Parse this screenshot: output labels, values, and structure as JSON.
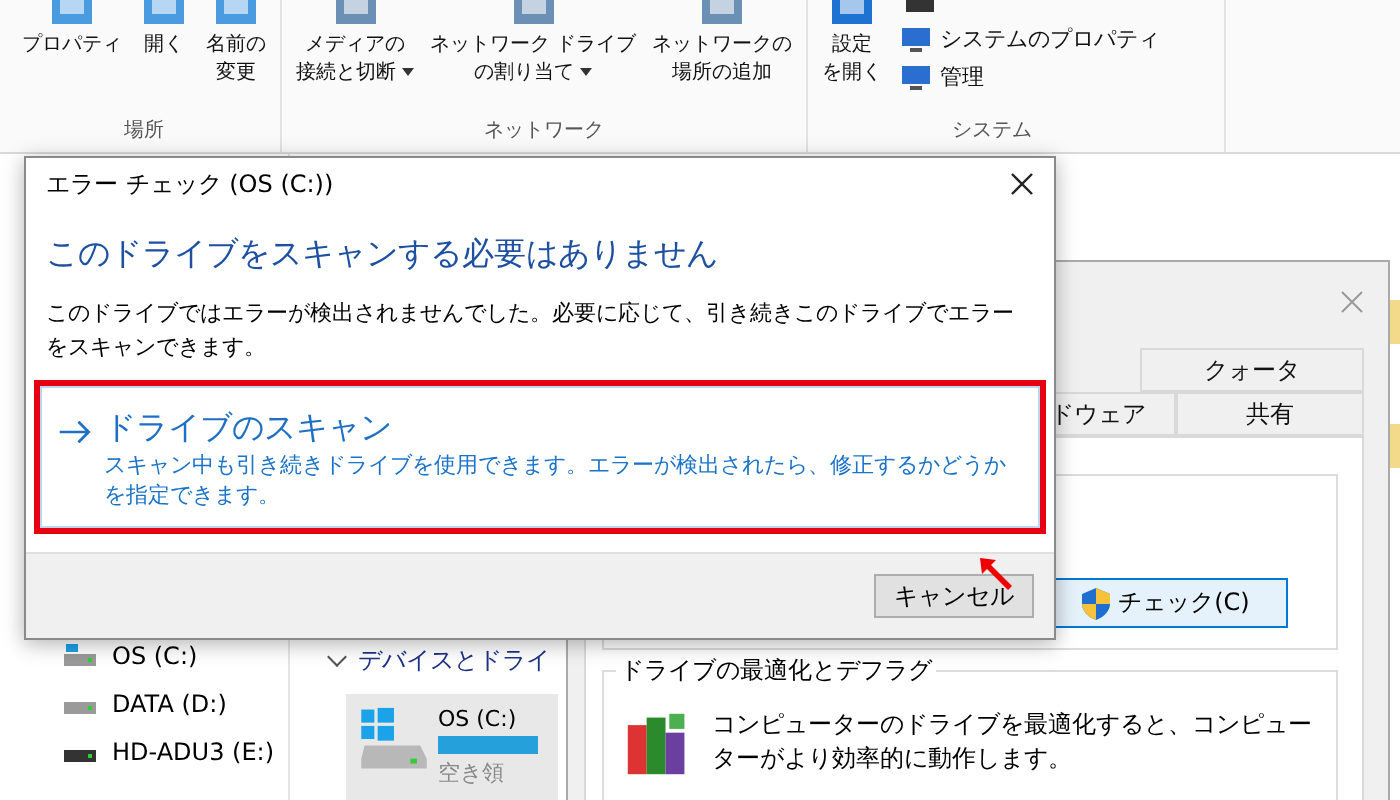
{
  "ribbon": {
    "groups": [
      {
        "label": "場所",
        "items": [
          {
            "kind": "large",
            "lines": [
              "プロパティ"
            ],
            "dropdown": false
          },
          {
            "kind": "large",
            "lines": [
              "開く"
            ],
            "dropdown": false
          },
          {
            "kind": "large",
            "lines": [
              "名前の",
              "変更"
            ],
            "dropdown": false
          }
        ]
      },
      {
        "label": "ネットワーク",
        "items": [
          {
            "kind": "large",
            "lines": [
              "メディアの",
              "接続と切断"
            ],
            "dropdown": true
          },
          {
            "kind": "large",
            "lines": [
              "ネットワーク ドライブ",
              "の割り当て"
            ],
            "dropdown": true
          },
          {
            "kind": "large",
            "lines": [
              "ネットワークの",
              "場所の追加"
            ],
            "dropdown": false
          }
        ]
      },
      {
        "label": "システム",
        "items": [
          {
            "kind": "large",
            "lines": [
              "設定",
              "を開く"
            ],
            "dropdown": false
          },
          {
            "kind": "small",
            "lines": [
              "システムのプロパティ"
            ],
            "dropdown": false
          },
          {
            "kind": "small",
            "lines": [
              "管理"
            ],
            "dropdown": false
          }
        ]
      }
    ]
  },
  "navigation": {
    "items": [
      {
        "label": "OS (C:)",
        "kind": "system"
      },
      {
        "label": "DATA (D:)",
        "kind": "drive"
      },
      {
        "label": "HD-ADU3 (E:)",
        "kind": "external"
      }
    ]
  },
  "content": {
    "section": {
      "title": "デバイスとドライ",
      "expanded": true
    },
    "drive": {
      "name": "OS (C:)",
      "detail": "空き領"
    }
  },
  "properties_window": {
    "tab_rows": [
      [
        {
          "label": "クォータ",
          "selected": false
        }
      ],
      [
        {
          "label": "ドウェア",
          "selected": false
        },
        {
          "label": "共有",
          "selected": false
        }
      ]
    ],
    "check_button": "チェック(C)",
    "optimize": {
      "title": "ドライブの最適化とデフラグ",
      "description": "コンピューターのドライブを最適化すると、コンピューターがより効率的に動作します。"
    }
  },
  "dialog": {
    "title": "エラー チェック (OS (C:))",
    "heading": "このドライブをスキャンする必要はありません",
    "message": "このドライブではエラーが検出されませんでした。必要に応じて、引き続きこのドライブでエラーをスキャンできます。",
    "option": {
      "title": "ドライブのスキャン",
      "description": "スキャン中も引き続きドライブを使用できます。エラーが検出されたら、修正するかどうかを指定できます。",
      "highlighted": true
    },
    "buttons": [
      "キャンセル"
    ]
  }
}
